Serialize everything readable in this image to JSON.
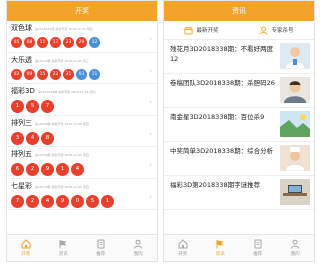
{
  "left": {
    "title": "开奖",
    "lotteries": [
      {
        "name": "双色球",
        "meta": "第2018142期 最新开奖 2018-12-06 周四",
        "balls": [
          "05",
          "08",
          "11",
          "17",
          "23",
          "29",
          "12"
        ],
        "blue_count": 1,
        "big": false
      },
      {
        "name": "大乐透",
        "meta": "第18143期 最新开奖 2018-12-05 周三",
        "balls": [
          "02",
          "09",
          "15",
          "22",
          "31",
          "03",
          "11"
        ],
        "blue_count": 2,
        "big": false
      },
      {
        "name": "福彩3D",
        "meta": "第2018338期 最新开奖 2018-12-06 周四",
        "balls": [
          "1",
          "5",
          "7"
        ],
        "blue_count": 0,
        "big": true
      },
      {
        "name": "排列三",
        "meta": "第18338期 最新开奖 2018-12-06 周四",
        "balls": [
          "3",
          "4",
          "8"
        ],
        "blue_count": 0,
        "big": true
      },
      {
        "name": "排列五",
        "meta": "第18338期 最新开奖 2018-12-06 周四",
        "balls": [
          "6",
          "2",
          "9",
          "1",
          "4"
        ],
        "blue_count": 0,
        "big": true
      },
      {
        "name": "七星彩",
        "meta": "第18143期 最新开奖 2018-12-06 周四",
        "balls": [
          "7",
          "2",
          "4",
          "9",
          "0",
          "5",
          "1"
        ],
        "blue_count": 0,
        "big": true
      }
    ]
  },
  "right": {
    "title": "资讯",
    "subtabs": [
      "最新开奖",
      "专家杀号"
    ],
    "news": [
      {
        "title": "残花月3D2018338期：不看好两度12",
        "thumb": "doctor"
      },
      {
        "title": "卷稿团队3D2018338期：杀胆码26",
        "thumb": "person"
      },
      {
        "title": "南金星3D2018338期：百位杀9",
        "thumb": "scene"
      },
      {
        "title": "中奖简单3D2018338期：综合分析",
        "thumb": "chef"
      },
      {
        "title": "福彩3D第2018338期字谜推荐",
        "thumb": "desk"
      }
    ]
  },
  "nav": [
    {
      "label": "开奖",
      "icon": "home-icon"
    },
    {
      "label": "资讯",
      "icon": "flag-icon"
    },
    {
      "label": "推荐",
      "icon": "document-icon"
    },
    {
      "label": "我的",
      "icon": "user-icon"
    }
  ],
  "left_active_nav": 0,
  "right_active_nav": 1,
  "colors": {
    "accent": "#f4a32a",
    "red_ball": "#e8402d",
    "blue_ball": "#4a90d9"
  }
}
